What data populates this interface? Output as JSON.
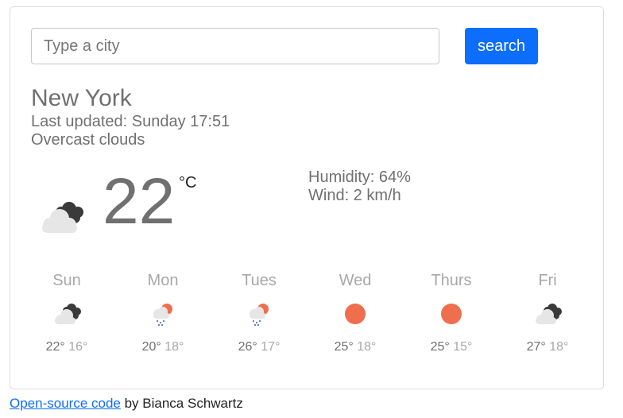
{
  "search": {
    "placeholder": "Type a city",
    "value": "",
    "button_label": "search"
  },
  "current": {
    "city": "New York",
    "last_updated": "Last updated: Sunday 17:51",
    "description": "Overcast clouds",
    "temperature": "22",
    "unit": "°C",
    "humidity": "Humidity: 64%",
    "wind": "Wind: 2 km/h",
    "icon": "overcast-clouds-icon"
  },
  "forecast": [
    {
      "day": "Sun",
      "max": "22°",
      "min": "16°",
      "icon": "overcast-clouds-icon"
    },
    {
      "day": "Mon",
      "max": "20°",
      "min": "18°",
      "icon": "rain-sun-icon"
    },
    {
      "day": "Tues",
      "max": "26°",
      "min": "17°",
      "icon": "rain-sun-icon"
    },
    {
      "day": "Wed",
      "max": "25°",
      "min": "18°",
      "icon": "sun-icon"
    },
    {
      "day": "Thurs",
      "max": "25°",
      "min": "15°",
      "icon": "sun-icon"
    },
    {
      "day": "Fri",
      "max": "27°",
      "min": "18°",
      "icon": "overcast-clouds-icon"
    }
  ],
  "footer": {
    "link_text": "Open-source code",
    "suffix": " by Bianca Schwartz"
  },
  "colors": {
    "accent": "#0d6efd",
    "sun": "#ee6e4e",
    "dark_cloud": "#3a3a3a",
    "light_cloud": "#e6e6e6",
    "rain": "#2f5fb0"
  }
}
